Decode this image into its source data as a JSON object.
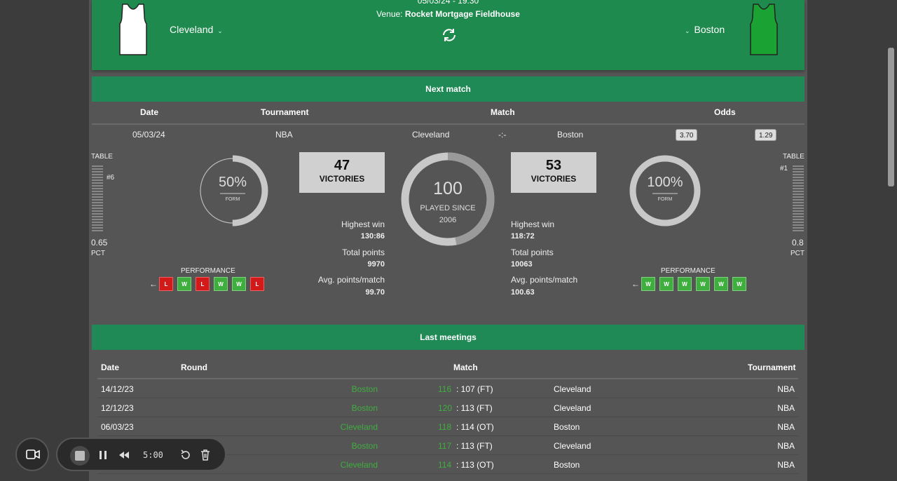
{
  "header": {
    "datetime": "05/03/24 - 19:30",
    "venue_label": "Venue:",
    "venue_name": "Rocket Mortgage Fieldhouse",
    "home_team": "Cleveland",
    "away_team": "Boston",
    "home_jersey_color": "#ffffff",
    "away_jersey_color": "#1aa332"
  },
  "next_match": {
    "title": "Next match",
    "headers": {
      "date": "Date",
      "tournament": "Tournament",
      "match": "Match",
      "odds": "Odds"
    },
    "date": "05/03/24",
    "tournament": "NBA",
    "home": "Cleveland",
    "score": "-:-",
    "away": "Boston",
    "odd_home": "3.70",
    "odd_away": "1.29"
  },
  "home_stats": {
    "table_label": "TABLE",
    "rank": "#6",
    "pct": "0.65",
    "pct_label": "PCT",
    "form_pct": "50%",
    "form_label": "FORM",
    "form_value": 0.5,
    "victories": "47",
    "victories_label": "VICTORIES",
    "highest_win_label": "Highest win",
    "highest_win": "130:86",
    "total_points_label": "Total points",
    "total_points": "9970",
    "avg_label": "Avg. points/match",
    "avg": "99.70",
    "performance_label": "PERFORMANCE",
    "performance": [
      "L",
      "W",
      "L",
      "W",
      "W",
      "L"
    ]
  },
  "away_stats": {
    "table_label": "TABLE",
    "rank": "#1",
    "pct": "0.8",
    "pct_label": "PCT",
    "form_pct": "100%",
    "form_label": "FORM",
    "form_value": 1.0,
    "victories": "53",
    "victories_label": "VICTORIES",
    "highest_win_label": "Highest win",
    "highest_win": "118:72",
    "total_points_label": "Total points",
    "total_points": "10063",
    "avg_label": "Avg. points/match",
    "avg": "100.63",
    "performance_label": "PERFORMANCE",
    "performance": [
      "W",
      "W",
      "W",
      "W",
      "W",
      "W"
    ]
  },
  "center": {
    "played": "100",
    "played_label": "PLAYED SINCE",
    "since": "2006",
    "home_share": 0.47
  },
  "last_meetings": {
    "title": "Last meetings",
    "headers": {
      "date": "Date",
      "round": "Round",
      "match": "Match",
      "tournament": "Tournament"
    },
    "rows": [
      {
        "date": "14/12/23",
        "winner": "Boston",
        "win_score": "116",
        "rest": ": 107 (FT)",
        "loser": "Cleveland",
        "tournament": "NBA"
      },
      {
        "date": "12/12/23",
        "winner": "Boston",
        "win_score": "120",
        "rest": ": 113 (FT)",
        "loser": "Cleveland",
        "tournament": "NBA"
      },
      {
        "date": "06/03/23",
        "winner": "Cleveland",
        "win_score": "118",
        "rest": ": 114 (OT)",
        "loser": "Boston",
        "tournament": "NBA"
      },
      {
        "date": "",
        "winner": "Boston",
        "win_score": "117",
        "rest": ": 113 (FT)",
        "loser": "Cleveland",
        "tournament": "NBA"
      },
      {
        "date": "",
        "winner": "Cleveland",
        "win_score": "114",
        "rest": ": 113 (OT)",
        "loser": "Boston",
        "tournament": "NBA"
      }
    ]
  },
  "recorder": {
    "time": "5:00"
  }
}
